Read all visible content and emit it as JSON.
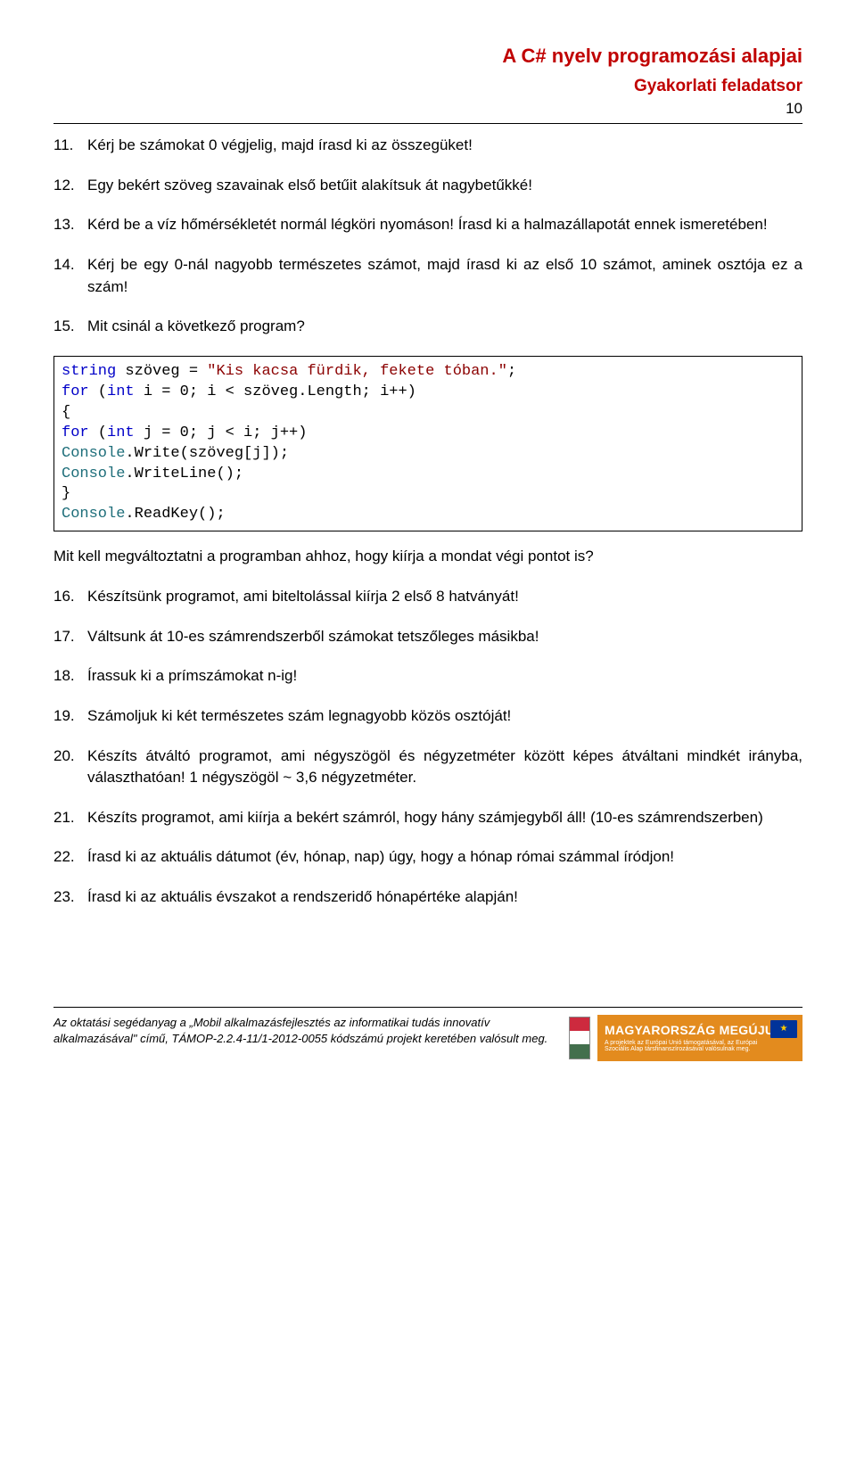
{
  "header": {
    "title1": "A C# nyelv programozási alapjai",
    "title2": "Gyakorlati feladatsor",
    "page_num": "10"
  },
  "items": [
    {
      "num": "11.",
      "text": "Kérj be számokat 0 végjelig, majd írasd ki az összegüket!"
    },
    {
      "num": "12.",
      "text": "Egy bekért szöveg szavainak első betűit alakítsuk át nagybetűkké!"
    },
    {
      "num": "13.",
      "text": "Kérd be a víz hőmérsékletét normál légköri nyomáson! Írasd ki a halmazállapotát ennek ismeretében!"
    },
    {
      "num": "14.",
      "text": "Kérj be egy 0-nál nagyobb természetes számot, majd írasd ki az első 10 számot, aminek osztója ez a szám!"
    },
    {
      "num": "15.",
      "text": "Mit csinál a következő program?"
    }
  ],
  "code": {
    "l1a": "string",
    "l1b": " szöveg = ",
    "l1c": "\"Kis kacsa fürdik, fekete tóban.\"",
    "l1d": ";",
    "l2a": "for",
    "l2b": " (",
    "l2c": "int",
    "l2d": " i = 0; i < szöveg.Length; i++)",
    "l3": "{",
    "l4a": "for",
    "l4b": " (",
    "l4c": "int",
    "l4d": " j = 0; j < i; j++)",
    "l5a": "Console",
    "l5b": ".Write(szöveg[j]);",
    "l6a": "Console",
    "l6b": ".WriteLine();",
    "l7": "}",
    "l8a": "Console",
    "l8b": ".ReadKey();"
  },
  "sub15": "Mit kell megváltoztatni a programban ahhoz, hogy kiírja a mondat végi pontot is?",
  "items2": [
    {
      "num": "16.",
      "text": "Készítsünk programot, ami biteltolással kiírja 2 első 8 hatványát!"
    },
    {
      "num": "17.",
      "text": "Váltsunk át 10-es számrendszerből számokat tetszőleges másikba!"
    },
    {
      "num": "18.",
      "text": "Írassuk ki a prímszámokat n-ig!"
    },
    {
      "num": "19.",
      "text": "Számoljuk ki két természetes szám legnagyobb közös osztóját!"
    },
    {
      "num": "20.",
      "text": "Készíts átváltó programot, ami négyszögöl és négyzetméter között képes átváltani mindkét irányba, választhatóan! 1 négyszögöl ~ 3,6 négyzetméter."
    },
    {
      "num": "21.",
      "text": "Készíts programot, ami kiírja a bekért számról, hogy hány számjegyből áll! (10-es számrendszerben)"
    },
    {
      "num": "22.",
      "text": "Írasd ki az aktuális dátumot (év, hónap, nap) úgy, hogy a hónap római számmal íródjon!"
    },
    {
      "num": "23.",
      "text": "Írasd ki az aktuális évszakot a rendszeridő hónapértéke alapján!"
    }
  ],
  "footer": {
    "text_pre": "Az oktatási segédanyag a ",
    "text_title": "„Mobil alkalmazásfejlesztés az informatikai tudás innovatív alkalmazásával\"",
    "text_mid": " című, ",
    "text_code": "TÁMOP-2.2.4-11/1-2012-0055",
    "text_post": " kódszámú projekt keretében valósult meg.",
    "badge_big": "MAGYARORSZÁG MEGÚJUL",
    "badge_small": "A projektek az Európai Unió támogatásával, az Európai Szociális Alap társfinanszírozásával valósulnak meg."
  }
}
